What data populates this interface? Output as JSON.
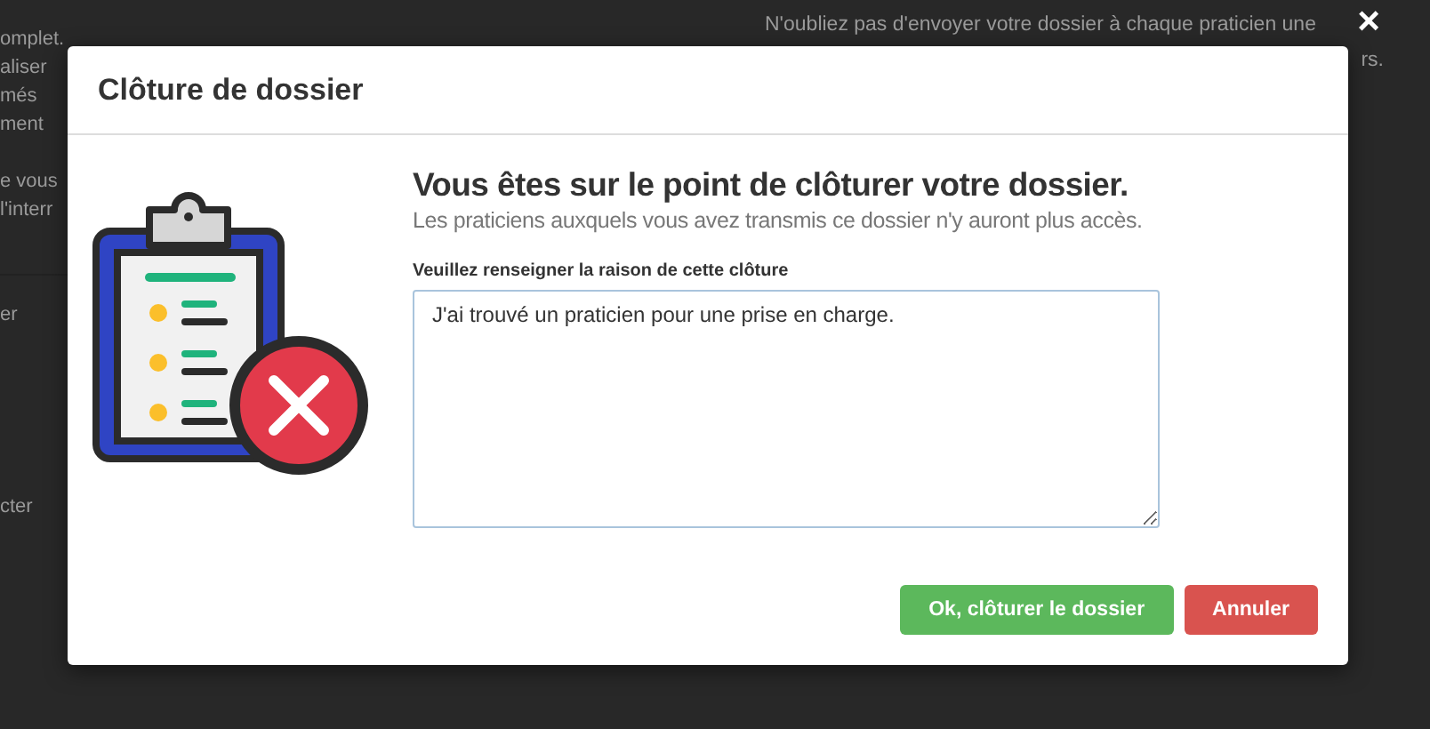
{
  "background": {
    "left_lines": [
      "omplet.",
      "aliser",
      "més",
      "ment",
      "e vous",
      "l'interr"
    ],
    "left_labels": [
      "er",
      "cter"
    ],
    "right_lines": [
      "N'oubliez pas d'envoyer votre dossier à chaque praticien une"
    ],
    "right_tail": "rs."
  },
  "close_icon": "×",
  "modal": {
    "title": "Clôture de dossier",
    "heading": "Vous êtes sur le point de clôturer votre dossier.",
    "subtitle": "Les praticiens auxquels vous avez transmis ce dossier n'y auront plus accès.",
    "field_label": "Veuillez renseigner la raison de cette clôture",
    "field_value": "J'ai trouvé un praticien pour une prise en charge.",
    "buttons": [
      {
        "label": "Ok, clôturer le dossier",
        "kind": "confirm"
      },
      {
        "label": "Annuler",
        "kind": "cancel"
      }
    ]
  }
}
